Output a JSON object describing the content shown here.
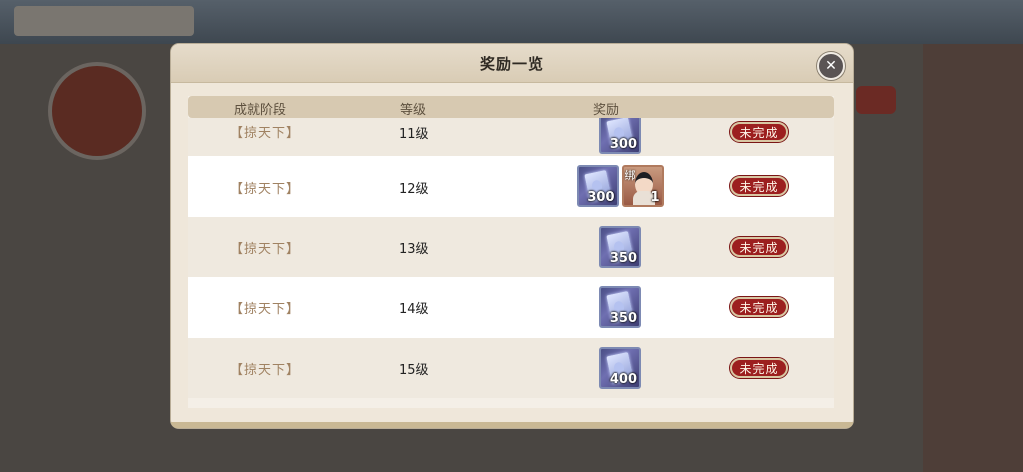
{
  "modal": {
    "title": "奖励一览",
    "close_icon": "close-icon"
  },
  "table": {
    "headers": {
      "stage": "成就阶段",
      "level": "等级",
      "reward": "奖励"
    },
    "rows": [
      {
        "stage": "【掠天下】",
        "level": "11级",
        "rewards": [
          {
            "icon": "card-item-icon",
            "qty": "300"
          }
        ],
        "status": "未完成"
      },
      {
        "stage": "【掠天下】",
        "level": "12级",
        "rewards": [
          {
            "icon": "card-item-icon",
            "qty": "300"
          },
          {
            "icon": "character-item-icon",
            "tag": "绑",
            "qty": "1"
          }
        ],
        "status": "未完成"
      },
      {
        "stage": "【掠天下】",
        "level": "13级",
        "rewards": [
          {
            "icon": "card-item-icon",
            "qty": "350"
          }
        ],
        "status": "未完成"
      },
      {
        "stage": "【掠天下】",
        "level": "14级",
        "rewards": [
          {
            "icon": "card-item-icon",
            "qty": "350"
          }
        ],
        "status": "未完成"
      },
      {
        "stage": "【掠天下】",
        "level": "15级",
        "rewards": [
          {
            "icon": "card-item-icon",
            "qty": "400"
          }
        ],
        "status": "未完成"
      }
    ]
  },
  "colors": {
    "status_red": "#9c1f1f",
    "stage_text": "#a08262",
    "modal_bg": "#efe7da"
  }
}
